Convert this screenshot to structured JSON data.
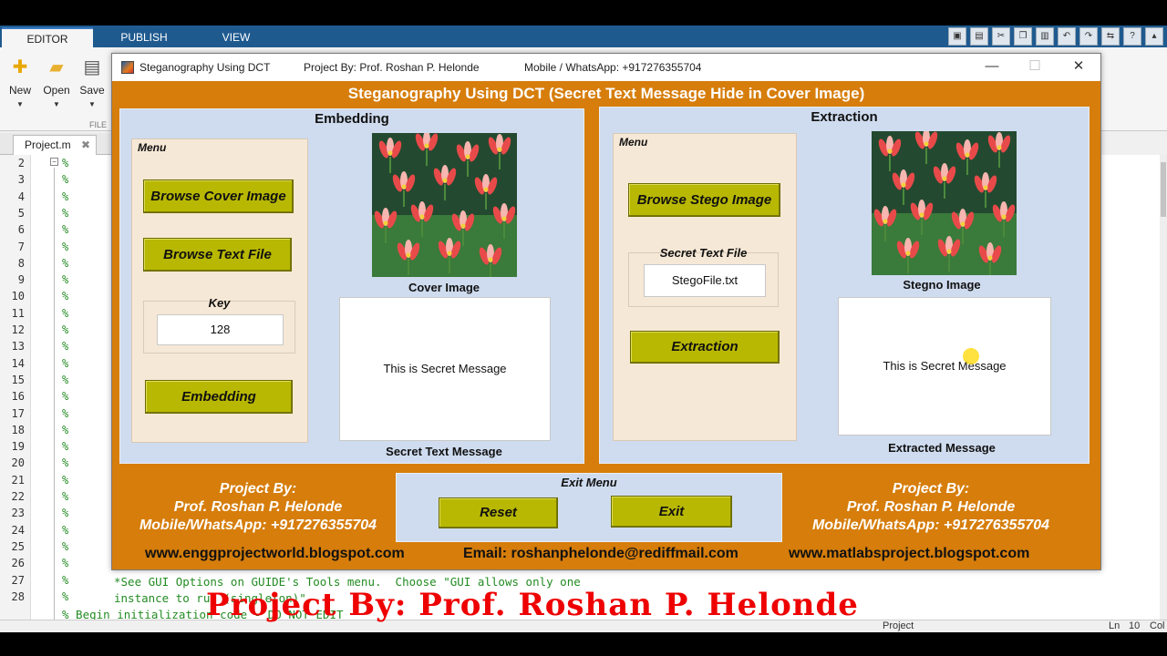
{
  "ribbon": {
    "tabs": [
      "EDITOR",
      "PUBLISH",
      "VIEW"
    ],
    "buttons": [
      {
        "label": "New",
        "icon": "plus-icon"
      },
      {
        "label": "Open",
        "icon": "folder-icon"
      },
      {
        "label": "Save",
        "icon": "floppy-icon"
      }
    ],
    "group_label": "FILE"
  },
  "editor": {
    "file_tab": "Project.m",
    "line_numbers": [
      "2",
      "3",
      "4",
      "5",
      "6",
      "7",
      "8",
      "9",
      "10",
      "11",
      "12",
      "13",
      "14",
      "15",
      "16",
      "17",
      "18",
      "19",
      "20",
      "21",
      "22",
      "23",
      "24",
      "25",
      "26",
      "27",
      "28"
    ],
    "comment_marker": "%",
    "code_line_27": "*See GUI Options on GUIDE's Tools menu.  Choose \"GUI allows only one",
    "code_line_28": "instance to run (singleton)\".",
    "code_line_29": "% Begin initialization code - DO NOT EDIT"
  },
  "statusbar": {
    "context": "Project",
    "ln_label": "Ln",
    "ln_value": "10",
    "col_label": "Col"
  },
  "watermark": "Project By: Prof. Roshan P. Helonde",
  "window": {
    "title": "Steganography Using DCT",
    "project_by": "Project By: Prof. Roshan P. Helonde",
    "mobile": "Mobile / WhatsApp: +917276355704",
    "heading": "Steganography Using DCT (Secret Text Message Hide in Cover Image)",
    "controls": {
      "minimize": "—",
      "maximize": "☐",
      "close": "✕"
    }
  },
  "embedding": {
    "title": "Embedding",
    "menu_label": "Menu",
    "browse_cover": "Browse Cover Image",
    "browse_text": "Browse Text File",
    "key_label": "Key",
    "key_value": "128",
    "embed_button": "Embedding",
    "cover_caption": "Cover Image",
    "message": "This is Secret Message",
    "message_caption": "Secret Text Message"
  },
  "extraction": {
    "title": "Extraction",
    "menu_label": "Menu",
    "browse_stego": "Browse Stego Image",
    "secret_file_label": "Secret Text File",
    "secret_file_value": "StegoFile.txt",
    "extract_button": "Extraction",
    "stego_caption": "Stegno Image",
    "message": "This is Secret Message",
    "message_caption": "Extracted Message"
  },
  "footer": {
    "left": [
      "Project By:",
      "Prof. Roshan P. Helonde",
      "Mobile/WhatsApp: +917276355704"
    ],
    "right": [
      "Project By:",
      "Prof. Roshan P. Helonde",
      "Mobile/WhatsApp: +917276355704"
    ],
    "exit_menu_label": "Exit Menu",
    "reset_button": "Reset",
    "exit_button": "Exit",
    "link_left": "www.enggprojectworld.blogspot.com",
    "email": "Email: roshanphelonde@rediffmail.com",
    "link_right": "www.matlabsproject.blogspot.com"
  },
  "colors": {
    "window_bg": "#d67d0b",
    "panel_bg": "#cfdcef",
    "button_bg": "#b8b803",
    "menu_bg": "#f6e8d6",
    "watermark": "#e00000"
  }
}
